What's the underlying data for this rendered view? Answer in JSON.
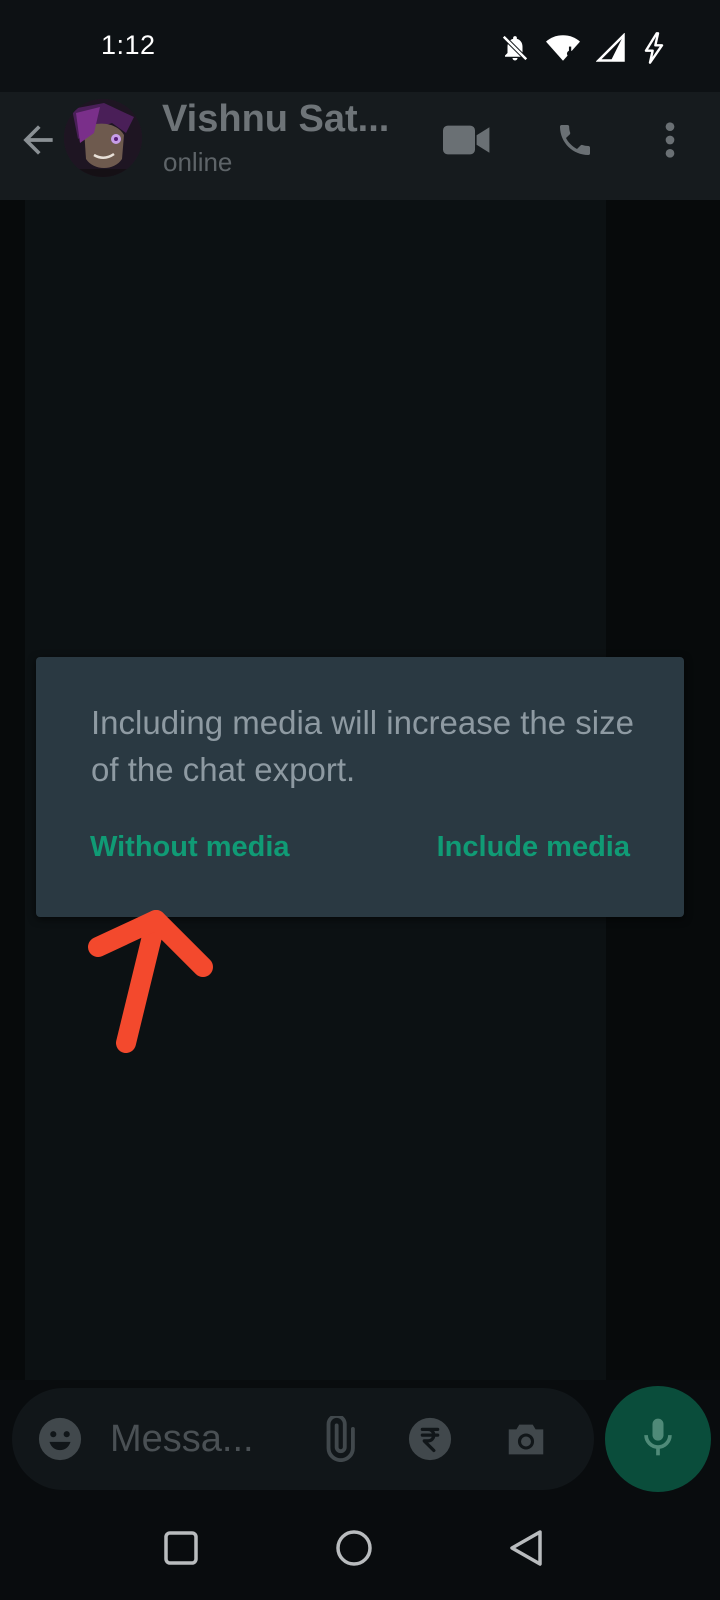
{
  "status_bar": {
    "time": "1:12",
    "icons": [
      "bell-off-icon",
      "wifi-icon",
      "signal-icon",
      "charging-icon"
    ]
  },
  "header": {
    "contact_name": "Vishnu Sat...",
    "contact_status": "online",
    "actions": [
      "back-arrow-icon",
      "video-call-icon",
      "voice-call-icon",
      "more-options-icon"
    ]
  },
  "dialog": {
    "message": "Including media will increase the size of the chat export.",
    "without_label": "Without media",
    "include_label": "Include media"
  },
  "composer": {
    "placeholder": "Messa...",
    "icons": [
      "emoji-icon",
      "attach-icon",
      "rupee-payment-icon",
      "camera-icon",
      "mic-icon"
    ]
  },
  "colors": {
    "accent_green": "#109b75",
    "dialog_bg": "#2a3942",
    "mic_button": "#0a4d3b",
    "annotation_arrow": "#f3492d"
  }
}
